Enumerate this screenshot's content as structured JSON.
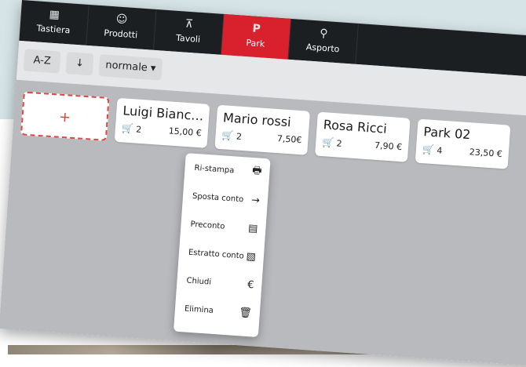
{
  "tabs": [
    {
      "label": "Tastiera",
      "icon": "keyboard-icon",
      "glyph": "▦"
    },
    {
      "label": "Prodotti",
      "icon": "food-icon",
      "glyph": "☺"
    },
    {
      "label": "Tavoli",
      "icon": "table-icon",
      "glyph": "⊼"
    },
    {
      "label": "Park",
      "icon": "park-icon",
      "glyph": "P",
      "active": true
    },
    {
      "label": "Asporto",
      "icon": "takeaway-icon",
      "glyph": "⚲"
    }
  ],
  "toolbar": {
    "sort_label": "A-Z",
    "sort_direction_glyph": "↓",
    "view_label": "normale ▾"
  },
  "add_card": {
    "glyph": "+"
  },
  "cards": [
    {
      "name": "Luigi Bianc…",
      "items": "2",
      "total": "15,00 €"
    },
    {
      "name": "Mario rossi",
      "items": "2",
      "total": "7,50€"
    },
    {
      "name": "Rosa Ricci",
      "items": "2",
      "total": "7,90 €"
    },
    {
      "name": "Park 02",
      "items": "4",
      "total": "23,50 €"
    }
  ],
  "context_menu": [
    {
      "label": "Ri-stampa",
      "icon": "printer-icon",
      "glyph": "🖶"
    },
    {
      "label": "Sposta conto",
      "icon": "arrow-right-icon",
      "glyph": "→"
    },
    {
      "label": "Preconto",
      "icon": "receipt-icon",
      "glyph": "▤"
    },
    {
      "label": "Estratto conto",
      "icon": "document-icon",
      "glyph": "▧"
    },
    {
      "label": "Chiudi",
      "icon": "euro-icon",
      "glyph": "€"
    },
    {
      "label": "Elimina",
      "icon": "trash-icon",
      "glyph": "🗑"
    }
  ],
  "colors": {
    "accent": "#d9212d",
    "tabbar": "#1c1f22",
    "content_bg": "#b9babe"
  }
}
